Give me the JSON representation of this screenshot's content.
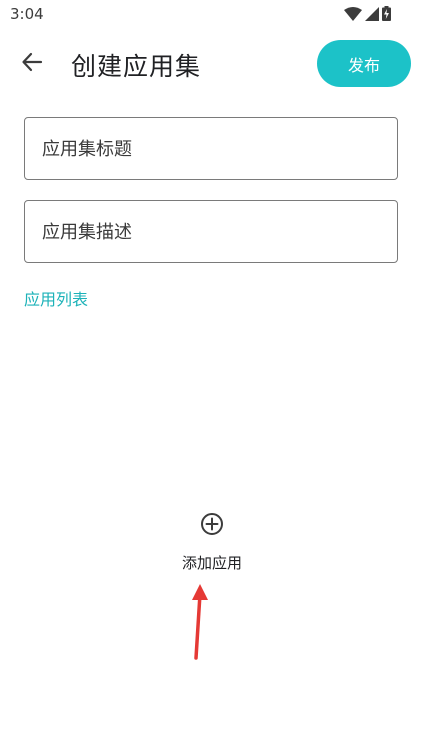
{
  "status_bar": {
    "time": "3:04"
  },
  "app_bar": {
    "title": "创建应用集",
    "publish_label": "发布"
  },
  "form": {
    "title_placeholder": "应用集标题",
    "description_placeholder": "应用集描述"
  },
  "app_list": {
    "section_label": "应用列表",
    "add_label": "添加应用"
  },
  "colors": {
    "accent": "#1cc2c8",
    "annotation_arrow": "#e53935"
  }
}
